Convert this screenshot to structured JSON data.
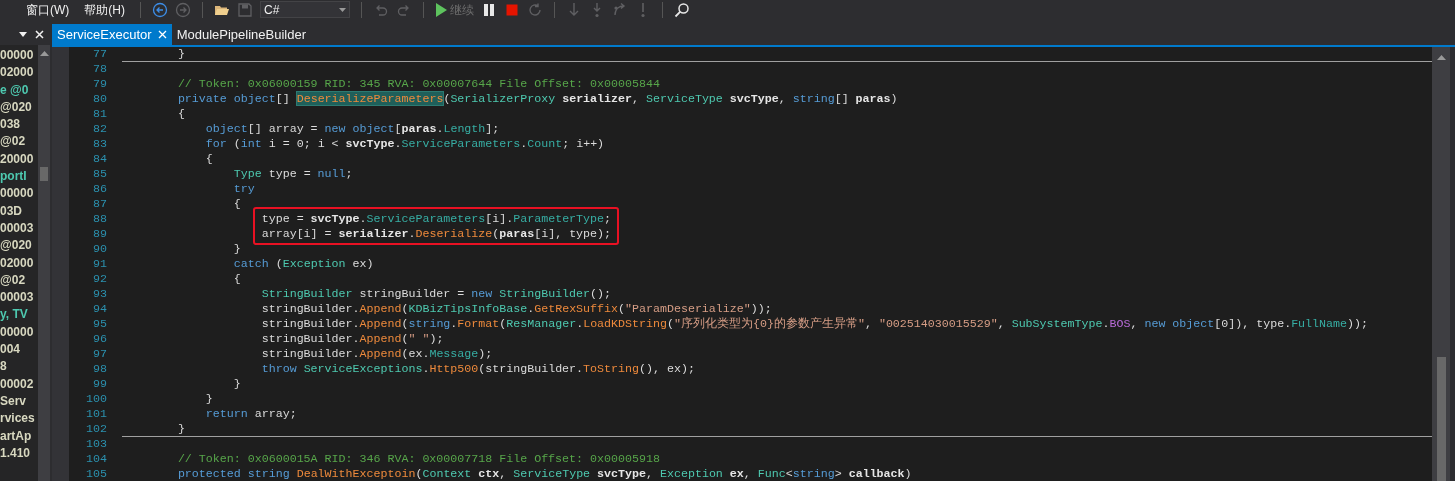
{
  "menu": [
    {
      "label": "窗口(W)"
    },
    {
      "label": "帮助(H)"
    }
  ],
  "toolbar_groups": [
    {
      "items": [
        {
          "kind": "back",
          "disabled": false
        },
        {
          "kind": "forward",
          "disabled": true
        }
      ]
    },
    {
      "items": [
        {
          "kind": "open",
          "disabled": false
        },
        {
          "kind": "save",
          "disabled": true
        },
        {
          "kind": "dropdown",
          "value": "C#",
          "disabled": false
        }
      ]
    },
    {
      "items": [
        {
          "kind": "undo",
          "disabled": true
        },
        {
          "kind": "redo",
          "disabled": true
        }
      ]
    },
    {
      "items": [
        {
          "kind": "continue",
          "label": "继续",
          "disabled": true
        },
        {
          "kind": "pause",
          "disabled": false
        },
        {
          "kind": "stop",
          "disabled": false
        },
        {
          "kind": "restart",
          "disabled": true
        }
      ]
    },
    {
      "items": [
        {
          "kind": "stepover",
          "disabled": true
        },
        {
          "kind": "stepinto",
          "disabled": true
        },
        {
          "kind": "stepout",
          "disabled": true
        },
        {
          "kind": "stepmore",
          "disabled": true
        }
      ]
    },
    {
      "items": [
        {
          "kind": "search",
          "disabled": false
        }
      ]
    }
  ],
  "side_panel": {
    "items": [
      {
        "text": "00000",
        "color": "#d8d8c0"
      },
      {
        "text": "02000",
        "color": "#d8d8c0"
      },
      {
        "text": "e @0",
        "color": "#4ec9b0"
      },
      {
        "text": "@020",
        "color": "#d8d8c0"
      },
      {
        "text": "038",
        "color": "#d8d8c0"
      },
      {
        "text": "@02",
        "color": "#d8d8c0"
      },
      {
        "text": "20000",
        "color": "#d8d8c0"
      },
      {
        "text": "portI",
        "color": "#4ec9b0"
      },
      {
        "text": "00000",
        "color": "#d8d8c0"
      },
      {
        "text": "03D",
        "color": "#d8d8c0"
      },
      {
        "text": "00003",
        "color": "#d8d8c0"
      },
      {
        "text": "@020",
        "color": "#d8d8c0"
      },
      {
        "text": "02000",
        "color": "#d8d8c0"
      },
      {
        "text": "@02",
        "color": "#d8d8c0"
      },
      {
        "text": "00003",
        "color": "#d8d8c0"
      },
      {
        "text": "y, TV",
        "color": "#4ec9b0"
      },
      {
        "text": "00000",
        "color": "#d8d8c0"
      },
      {
        "text": "004",
        "color": "#d8d8c0"
      },
      {
        "text": "8",
        "color": "#d8d8c0"
      },
      {
        "text": "00002",
        "color": "#d8d8c0"
      },
      {
        "text": "Serv",
        "color": "#d8d8c0"
      },
      {
        "text": "rvices",
        "color": "#d8d8c0"
      },
      {
        "text": "artAp",
        "color": "#d8d8c0"
      },
      {
        "text": "1.410",
        "color": "#d8d8c0"
      }
    ]
  },
  "tabs": [
    {
      "label": "ServiceExecutor",
      "selected": true
    },
    {
      "label": "ModulePipelineBuilder",
      "selected": false
    }
  ],
  "code_lines": [
    {
      "number": "77",
      "separator": false,
      "boxed": false,
      "tokens": [
        {
          "text": "        }",
          "kind": "plain"
        }
      ]
    },
    {
      "number": "78",
      "separator": true,
      "boxed": false
    },
    {
      "number": "79",
      "separator": false,
      "boxed": false,
      "tokens": [
        {
          "text": "        // Token: 0x06000159 RID: 345 RVA: 0x00007644 File Offset: 0x00005844",
          "kind": "comment"
        }
      ]
    },
    {
      "number": "80",
      "separator": false,
      "boxed": false,
      "tokens": [
        {
          "text": "        private ",
          "kind": "keyword"
        },
        {
          "text": "object",
          "kind": "keyword"
        },
        {
          "text": "[] ",
          "kind": "plain"
        },
        {
          "text": "DeserializeParameters",
          "kind": "highlighted"
        },
        {
          "text": "(",
          "kind": "plain"
        },
        {
          "text": "SerializerProxy ",
          "kind": "type"
        },
        {
          "text": "serializer",
          "kind": "param"
        },
        {
          "text": ", ",
          "kind": "plain"
        },
        {
          "text": "ServiceType ",
          "kind": "type"
        },
        {
          "text": "svcType",
          "kind": "param"
        },
        {
          "text": ", ",
          "kind": "plain"
        },
        {
          "text": "string",
          "kind": "keyword"
        },
        {
          "text": "[] ",
          "kind": "plain"
        },
        {
          "text": "paras",
          "kind": "param"
        },
        {
          "text": ")",
          "kind": "plain"
        }
      ]
    },
    {
      "number": "81",
      "separator": false,
      "boxed": false,
      "tokens": [
        {
          "text": "        {",
          "kind": "plain"
        }
      ]
    },
    {
      "number": "82",
      "separator": false,
      "boxed": false,
      "tokens": [
        {
          "text": "            object",
          "kind": "keyword"
        },
        {
          "text": "[] array = ",
          "kind": "plain"
        },
        {
          "text": "new ",
          "kind": "keyword"
        },
        {
          "text": "object",
          "kind": "keyword"
        },
        {
          "text": "[",
          "kind": "plain"
        },
        {
          "text": "paras",
          "kind": "param"
        },
        {
          "text": ".",
          "kind": "plain"
        },
        {
          "text": "Length",
          "kind": "property"
        },
        {
          "text": "];",
          "kind": "plain"
        }
      ]
    },
    {
      "number": "83",
      "separator": false,
      "boxed": false,
      "tokens": [
        {
          "text": "            for",
          "kind": "keyword"
        },
        {
          "text": " (",
          "kind": "plain"
        },
        {
          "text": "int",
          "kind": "keyword"
        },
        {
          "text": " i = 0; i < ",
          "kind": "plain"
        },
        {
          "text": "svcType",
          "kind": "param"
        },
        {
          "text": ".",
          "kind": "plain"
        },
        {
          "text": "ServiceParameters",
          "kind": "property"
        },
        {
          "text": ".",
          "kind": "plain"
        },
        {
          "text": "Count",
          "kind": "property"
        },
        {
          "text": "; i++)",
          "kind": "plain"
        }
      ]
    },
    {
      "number": "84",
      "separator": false,
      "boxed": false,
      "tokens": [
        {
          "text": "            {",
          "kind": "plain"
        }
      ]
    },
    {
      "number": "85",
      "separator": false,
      "boxed": false,
      "tokens": [
        {
          "text": "                Type",
          "kind": "type"
        },
        {
          "text": " type = ",
          "kind": "plain"
        },
        {
          "text": "null",
          "kind": "keyword"
        },
        {
          "text": ";",
          "kind": "plain"
        }
      ]
    },
    {
      "number": "86",
      "separator": false,
      "boxed": false,
      "tokens": [
        {
          "text": "                try",
          "kind": "keyword"
        }
      ]
    },
    {
      "number": "87",
      "separator": false,
      "boxed": false,
      "tokens": [
        {
          "text": "                {",
          "kind": "plain"
        }
      ]
    },
    {
      "number": "88",
      "separator": false,
      "boxed": true,
      "tokens": [
        {
          "text": "                    type = ",
          "kind": "plain"
        },
        {
          "text": "svcType",
          "kind": "param"
        },
        {
          "text": ".",
          "kind": "plain"
        },
        {
          "text": "ServiceParameters",
          "kind": "property"
        },
        {
          "text": "[i].",
          "kind": "plain"
        },
        {
          "text": "ParameterType",
          "kind": "property"
        },
        {
          "text": ";",
          "kind": "plain"
        }
      ]
    },
    {
      "number": "89",
      "separator": false,
      "boxed": true,
      "tokens": [
        {
          "text": "                    array[i] = ",
          "kind": "plain"
        },
        {
          "text": "serializer",
          "kind": "param"
        },
        {
          "text": ".",
          "kind": "plain"
        },
        {
          "text": "Deserialize",
          "kind": "method"
        },
        {
          "text": "(",
          "kind": "plain"
        },
        {
          "text": "paras",
          "kind": "param"
        },
        {
          "text": "[i], type);",
          "kind": "plain"
        }
      ]
    },
    {
      "number": "90",
      "separator": false,
      "boxed": false,
      "tokens": [
        {
          "text": "                }",
          "kind": "plain"
        }
      ]
    },
    {
      "number": "91",
      "separator": false,
      "boxed": false,
      "tokens": [
        {
          "text": "                catch",
          "kind": "keyword"
        },
        {
          "text": " (",
          "kind": "plain"
        },
        {
          "text": "Exception",
          "kind": "type"
        },
        {
          "text": " ex)",
          "kind": "plain"
        }
      ]
    },
    {
      "number": "92",
      "separator": false,
      "boxed": false,
      "tokens": [
        {
          "text": "                {",
          "kind": "plain"
        }
      ]
    },
    {
      "number": "93",
      "separator": false,
      "boxed": false,
      "tokens": [
        {
          "text": "                    StringBuilder",
          "kind": "type"
        },
        {
          "text": " stringBuilder = ",
          "kind": "plain"
        },
        {
          "text": "new ",
          "kind": "keyword"
        },
        {
          "text": "StringBuilder",
          "kind": "type"
        },
        {
          "text": "();",
          "kind": "plain"
        }
      ]
    },
    {
      "number": "94",
      "separator": false,
      "boxed": false,
      "tokens": [
        {
          "text": "                    stringBuilder.",
          "kind": "plain"
        },
        {
          "text": "Append",
          "kind": "method"
        },
        {
          "text": "(",
          "kind": "plain"
        },
        {
          "text": "KDBizTipsInfoBase",
          "kind": "type"
        },
        {
          "text": ".",
          "kind": "plain"
        },
        {
          "text": "GetRexSuffix",
          "kind": "method"
        },
        {
          "text": "(",
          "kind": "plain"
        },
        {
          "text": "\"ParamDeserialize\"",
          "kind": "string"
        },
        {
          "text": "));",
          "kind": "plain"
        }
      ]
    },
    {
      "number": "95",
      "separator": false,
      "boxed": false,
      "tokens": [
        {
          "text": "                    stringBuilder.",
          "kind": "plain"
        },
        {
          "text": "Append",
          "kind": "method"
        },
        {
          "text": "(",
          "kind": "plain"
        },
        {
          "text": "string",
          "kind": "keyword"
        },
        {
          "text": ".",
          "kind": "plain"
        },
        {
          "text": "Format",
          "kind": "method"
        },
        {
          "text": "(",
          "kind": "plain"
        },
        {
          "text": "ResManager",
          "kind": "type"
        },
        {
          "text": ".",
          "kind": "plain"
        },
        {
          "text": "LoadKDString",
          "kind": "method"
        },
        {
          "text": "(",
          "kind": "plain"
        },
        {
          "text": "\"序列化类型为{0}的参数产生异常\"",
          "kind": "string"
        },
        {
          "text": ", ",
          "kind": "plain"
        },
        {
          "text": "\"002514030015529\"",
          "kind": "string"
        },
        {
          "text": ", ",
          "kind": "plain"
        },
        {
          "text": "SubSystemType",
          "kind": "type"
        },
        {
          "text": ".",
          "kind": "plain"
        },
        {
          "text": "BOS",
          "kind": "enum"
        },
        {
          "text": ", ",
          "kind": "plain"
        },
        {
          "text": "new ",
          "kind": "keyword"
        },
        {
          "text": "object",
          "kind": "keyword"
        },
        {
          "text": "[0]), type.",
          "kind": "plain"
        },
        {
          "text": "FullName",
          "kind": "property"
        },
        {
          "text": "));",
          "kind": "plain"
        }
      ]
    },
    {
      "number": "96",
      "separator": false,
      "boxed": false,
      "tokens": [
        {
          "text": "                    stringBuilder.",
          "kind": "plain"
        },
        {
          "text": "Append",
          "kind": "method"
        },
        {
          "text": "(",
          "kind": "plain"
        },
        {
          "text": "\" \"",
          "kind": "string"
        },
        {
          "text": ");",
          "kind": "plain"
        }
      ]
    },
    {
      "number": "97",
      "separator": false,
      "boxed": false,
      "tokens": [
        {
          "text": "                    stringBuilder.",
          "kind": "plain"
        },
        {
          "text": "Append",
          "kind": "method"
        },
        {
          "text": "(ex.",
          "kind": "plain"
        },
        {
          "text": "Message",
          "kind": "property"
        },
        {
          "text": ");",
          "kind": "plain"
        }
      ]
    },
    {
      "number": "98",
      "separator": false,
      "boxed": false,
      "tokens": [
        {
          "text": "                    throw ",
          "kind": "keyword"
        },
        {
          "text": "ServiceExceptions",
          "kind": "type"
        },
        {
          "text": ".",
          "kind": "plain"
        },
        {
          "text": "Http500",
          "kind": "method"
        },
        {
          "text": "(stringBuilder.",
          "kind": "plain"
        },
        {
          "text": "ToString",
          "kind": "method"
        },
        {
          "text": "(), ex);",
          "kind": "plain"
        }
      ]
    },
    {
      "number": "99",
      "separator": false,
      "boxed": false,
      "tokens": [
        {
          "text": "                }",
          "kind": "plain"
        }
      ]
    },
    {
      "number": "100",
      "separator": false,
      "boxed": false,
      "tokens": [
        {
          "text": "            }",
          "kind": "plain"
        }
      ]
    },
    {
      "number": "101",
      "separator": false,
      "boxed": false,
      "tokens": [
        {
          "text": "            return",
          "kind": "keyword"
        },
        {
          "text": " array;",
          "kind": "plain"
        }
      ]
    },
    {
      "number": "102",
      "separator": false,
      "boxed": false,
      "tokens": [
        {
          "text": "        }",
          "kind": "plain"
        }
      ]
    },
    {
      "number": "103",
      "separator": true,
      "boxed": false
    },
    {
      "number": "104",
      "separator": false,
      "boxed": false,
      "tokens": [
        {
          "text": "        // Token: 0x0600015A RID: 346 RVA: 0x00007718 File Offset: 0x00005918",
          "kind": "comment"
        }
      ]
    },
    {
      "number": "105",
      "separator": false,
      "boxed": false,
      "tokens": [
        {
          "text": "        protected ",
          "kind": "keyword"
        },
        {
          "text": "string ",
          "kind": "keyword"
        },
        {
          "text": "DealWithExceptoin",
          "kind": "method"
        },
        {
          "text": "(",
          "kind": "plain"
        },
        {
          "text": "Context ",
          "kind": "type"
        },
        {
          "text": "ctx",
          "kind": "param"
        },
        {
          "text": ", ",
          "kind": "plain"
        },
        {
          "text": "ServiceType ",
          "kind": "type"
        },
        {
          "text": "svcType",
          "kind": "param"
        },
        {
          "text": ", ",
          "kind": "plain"
        },
        {
          "text": "Exception ",
          "kind": "type"
        },
        {
          "text": "ex",
          "kind": "param"
        },
        {
          "text": ", ",
          "kind": "plain"
        },
        {
          "text": "Func",
          "kind": "type"
        },
        {
          "text": "<",
          "kind": "plain"
        },
        {
          "text": "string",
          "kind": "keyword"
        },
        {
          "text": "> ",
          "kind": "plain"
        },
        {
          "text": "callback",
          "kind": "param"
        },
        {
          "text": ")",
          "kind": "plain"
        }
      ]
    }
  ]
}
